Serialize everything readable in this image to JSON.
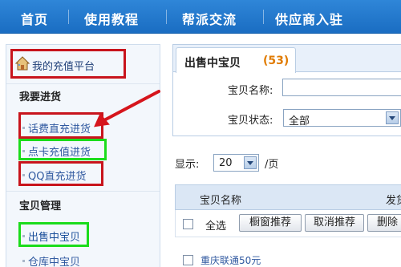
{
  "topnav": {
    "items": [
      "首页",
      "使用教程",
      "帮派交流",
      "供应商入驻"
    ]
  },
  "sidebar": {
    "platform_link": "我的充值平台",
    "section_stock": "我要进货",
    "stock_items": [
      "话费直充进货",
      "点卡充值进货",
      "QQ直充进货"
    ],
    "section_items": "宝贝管理",
    "item_links": [
      "出售中宝贝",
      "仓库中宝贝"
    ]
  },
  "main": {
    "tab_label": "出售中宝贝",
    "tab_count": "(53)",
    "tab_count_color": "#e07b00",
    "name_label": "宝贝名称:",
    "status_label": "宝贝状态:",
    "status_value": "全部",
    "show_label": "显示:",
    "page_size": "20",
    "page_unit": "/页"
  },
  "table": {
    "col_name": "宝贝名称",
    "col_ship": "发货",
    "select_all": "全选",
    "btn_window": "橱窗推荐",
    "btn_cancel": "取消推荐",
    "btn_delete": "删除",
    "first_item": "重庆联通50元"
  },
  "annotations": {
    "red": "#c8141c",
    "green": "#1bdc1b"
  }
}
